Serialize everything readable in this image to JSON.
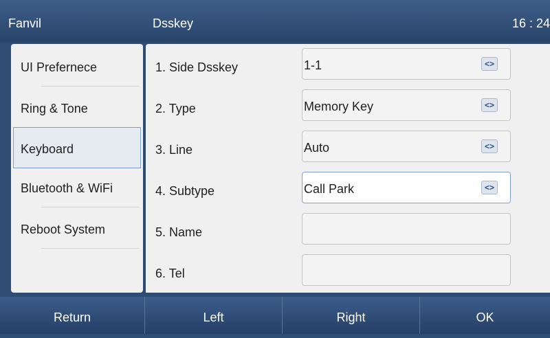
{
  "header": {
    "brand": "Fanvil",
    "title": "Dsskey",
    "time": "16 : 24"
  },
  "sidebar": {
    "items": [
      {
        "label": "UI Prefernece"
      },
      {
        "label": "Ring & Tone"
      },
      {
        "label": "Keyboard",
        "selected": true
      },
      {
        "label": "Bluetooth & WiFi"
      },
      {
        "label": "Reboot System"
      }
    ]
  },
  "form": {
    "rows": [
      {
        "label": "1.  Side Dsskey",
        "value": "1-1"
      },
      {
        "label": "2.  Type",
        "value": "Memory Key"
      },
      {
        "label": "3.  Line",
        "value": "Auto"
      },
      {
        "label": "4.  Subtype",
        "value": "Call Park"
      },
      {
        "label": "5.  Name",
        "value": ""
      },
      {
        "label": "6.  Tel",
        "value": ""
      }
    ],
    "switch_glyph": "<>"
  },
  "softkeys": {
    "return": "Return",
    "left": "Left",
    "right": "Right",
    "ok": "OK"
  },
  "colors": {
    "header_bg": "#2f4c73",
    "panel_bg": "#f0f0f0",
    "selected_border": "#7fa0cc",
    "text": "#1f1f1f"
  }
}
